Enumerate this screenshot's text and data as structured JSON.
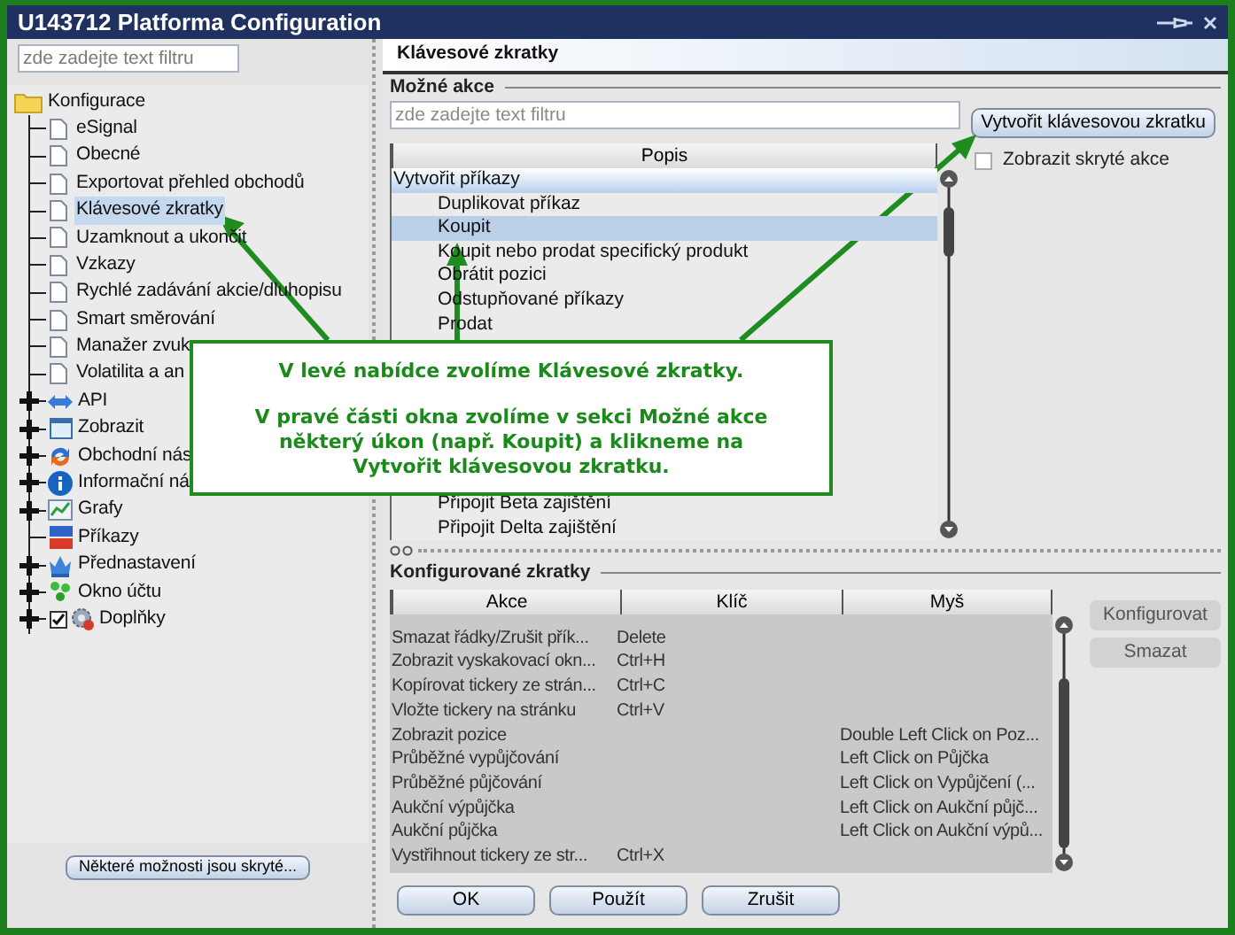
{
  "window": {
    "title": "U143712 Platforma Configuration"
  },
  "sidebar": {
    "filter_placeholder": "zde zadejte text filtru",
    "tree": {
      "label": "Konfigurace",
      "children": [
        {
          "label": "eSignal",
          "kind": "page",
          "selected": false
        },
        {
          "label": "Obecné",
          "kind": "page",
          "selected": false
        },
        {
          "label": "Exportovat přehled obchodů",
          "kind": "page",
          "selected": false
        },
        {
          "label": "Klávesové zkratky",
          "kind": "page",
          "selected": true
        },
        {
          "label": "Uzamknout a ukončit",
          "kind": "page",
          "selected": false
        },
        {
          "label": "Vzkazy",
          "kind": "page",
          "selected": false
        },
        {
          "label": "Rychlé zadávání akcie/dluhopisu",
          "kind": "page",
          "selected": false
        },
        {
          "label": "Smart směrování",
          "kind": "page",
          "selected": false
        },
        {
          "label": "Manažer zvuk",
          "kind": "page",
          "selected": false
        },
        {
          "label": "Volatilita a an",
          "kind": "page",
          "selected": false
        },
        {
          "label": "API",
          "kind": "group",
          "selected": false
        },
        {
          "label": "Zobrazit",
          "kind": "group",
          "selected": false
        },
        {
          "label": "Obchodní nás",
          "kind": "group",
          "selected": false
        },
        {
          "label": "Informační ná",
          "kind": "group",
          "selected": false
        },
        {
          "label": "Grafy",
          "kind": "group",
          "selected": false
        },
        {
          "label": "Příkazy",
          "kind": "leaf",
          "selected": false
        },
        {
          "label": "Přednastavení",
          "kind": "group",
          "selected": false
        },
        {
          "label": "Okno účtu",
          "kind": "group",
          "selected": false
        },
        {
          "label": "Doplňky",
          "kind": "checkgroup",
          "selected": false,
          "checked": true
        }
      ]
    },
    "hidden_options_button": "Některé možnosti jsou skryté..."
  },
  "panel": {
    "title": "Klávesové zkratky",
    "possible_actions": {
      "heading": "Možné akce",
      "filter_placeholder": "zde zadejte text filtru",
      "create_button": "Vytvořit klávesovou zkratku",
      "show_hidden": {
        "label": "Zobrazit skryté akce",
        "checked": false
      },
      "column": "Popis",
      "rows": [
        {
          "label": "Vytvořit příkazy",
          "kind": "category",
          "selected": false
        },
        {
          "label": "Duplikovat příkaz",
          "kind": "action",
          "selected": false
        },
        {
          "label": "Koupit",
          "kind": "action",
          "selected": true
        },
        {
          "label": "Koupit nebo prodat specifický produkt",
          "kind": "action",
          "selected": false
        },
        {
          "label": "Obrátit pozici",
          "kind": "action",
          "selected": false
        },
        {
          "label": "Odstupňované příkazy",
          "kind": "action",
          "selected": false
        },
        {
          "label": "Prodat",
          "kind": "action",
          "selected": false
        },
        {
          "label": "Připojit Beta zajištění",
          "kind": "action",
          "selected": false
        },
        {
          "label": "Připojit Delta zajištění",
          "kind": "action",
          "selected": false
        }
      ]
    },
    "configured": {
      "heading": "Konfigurované zkratky",
      "columns": [
        "Akce",
        "Klíč",
        "Myš"
      ],
      "rows": [
        {
          "action": "Smazat řádky/Zrušit přík...",
          "key": "Delete"
        },
        {
          "action": "Zobrazit vyskakovací okn...",
          "key": "Ctrl+H"
        },
        {
          "action": "Kopírovat tickery ze strán...",
          "key": "Ctrl+C"
        },
        {
          "action": "Vložte tickery na stránku",
          "key": "Ctrl+V"
        },
        {
          "action": "Zobrazit pozice",
          "mouse": "Double Left Click on Poz..."
        },
        {
          "action": "Průběžné vypůjčování",
          "mouse": "Left Click on Půjčka"
        },
        {
          "action": "Průběžné půjčování",
          "mouse": "Left Click on Vypůjčení (..."
        },
        {
          "action": "Aukční výpůjčka",
          "mouse": "Left Click on Aukční půjč..."
        },
        {
          "action": "Aukční půjčka",
          "mouse": "Left Click on Aukční výpů..."
        },
        {
          "action": "Vystřihnout tickery ze str...",
          "key": "Ctrl+X"
        }
      ],
      "buttons": [
        "Konfigurovat",
        "Smazat"
      ]
    }
  },
  "footer_buttons": [
    "OK",
    "Použít",
    "Zrušit"
  ],
  "callout": {
    "lines": [
      "V levé nabídce zvolíme Klávesové zkratky.",
      "V pravé části okna zvolíme v sekci Možné akce některý úkon (např. Koupit) a klikneme na Vytvořit klávesovou zkratku."
    ]
  }
}
